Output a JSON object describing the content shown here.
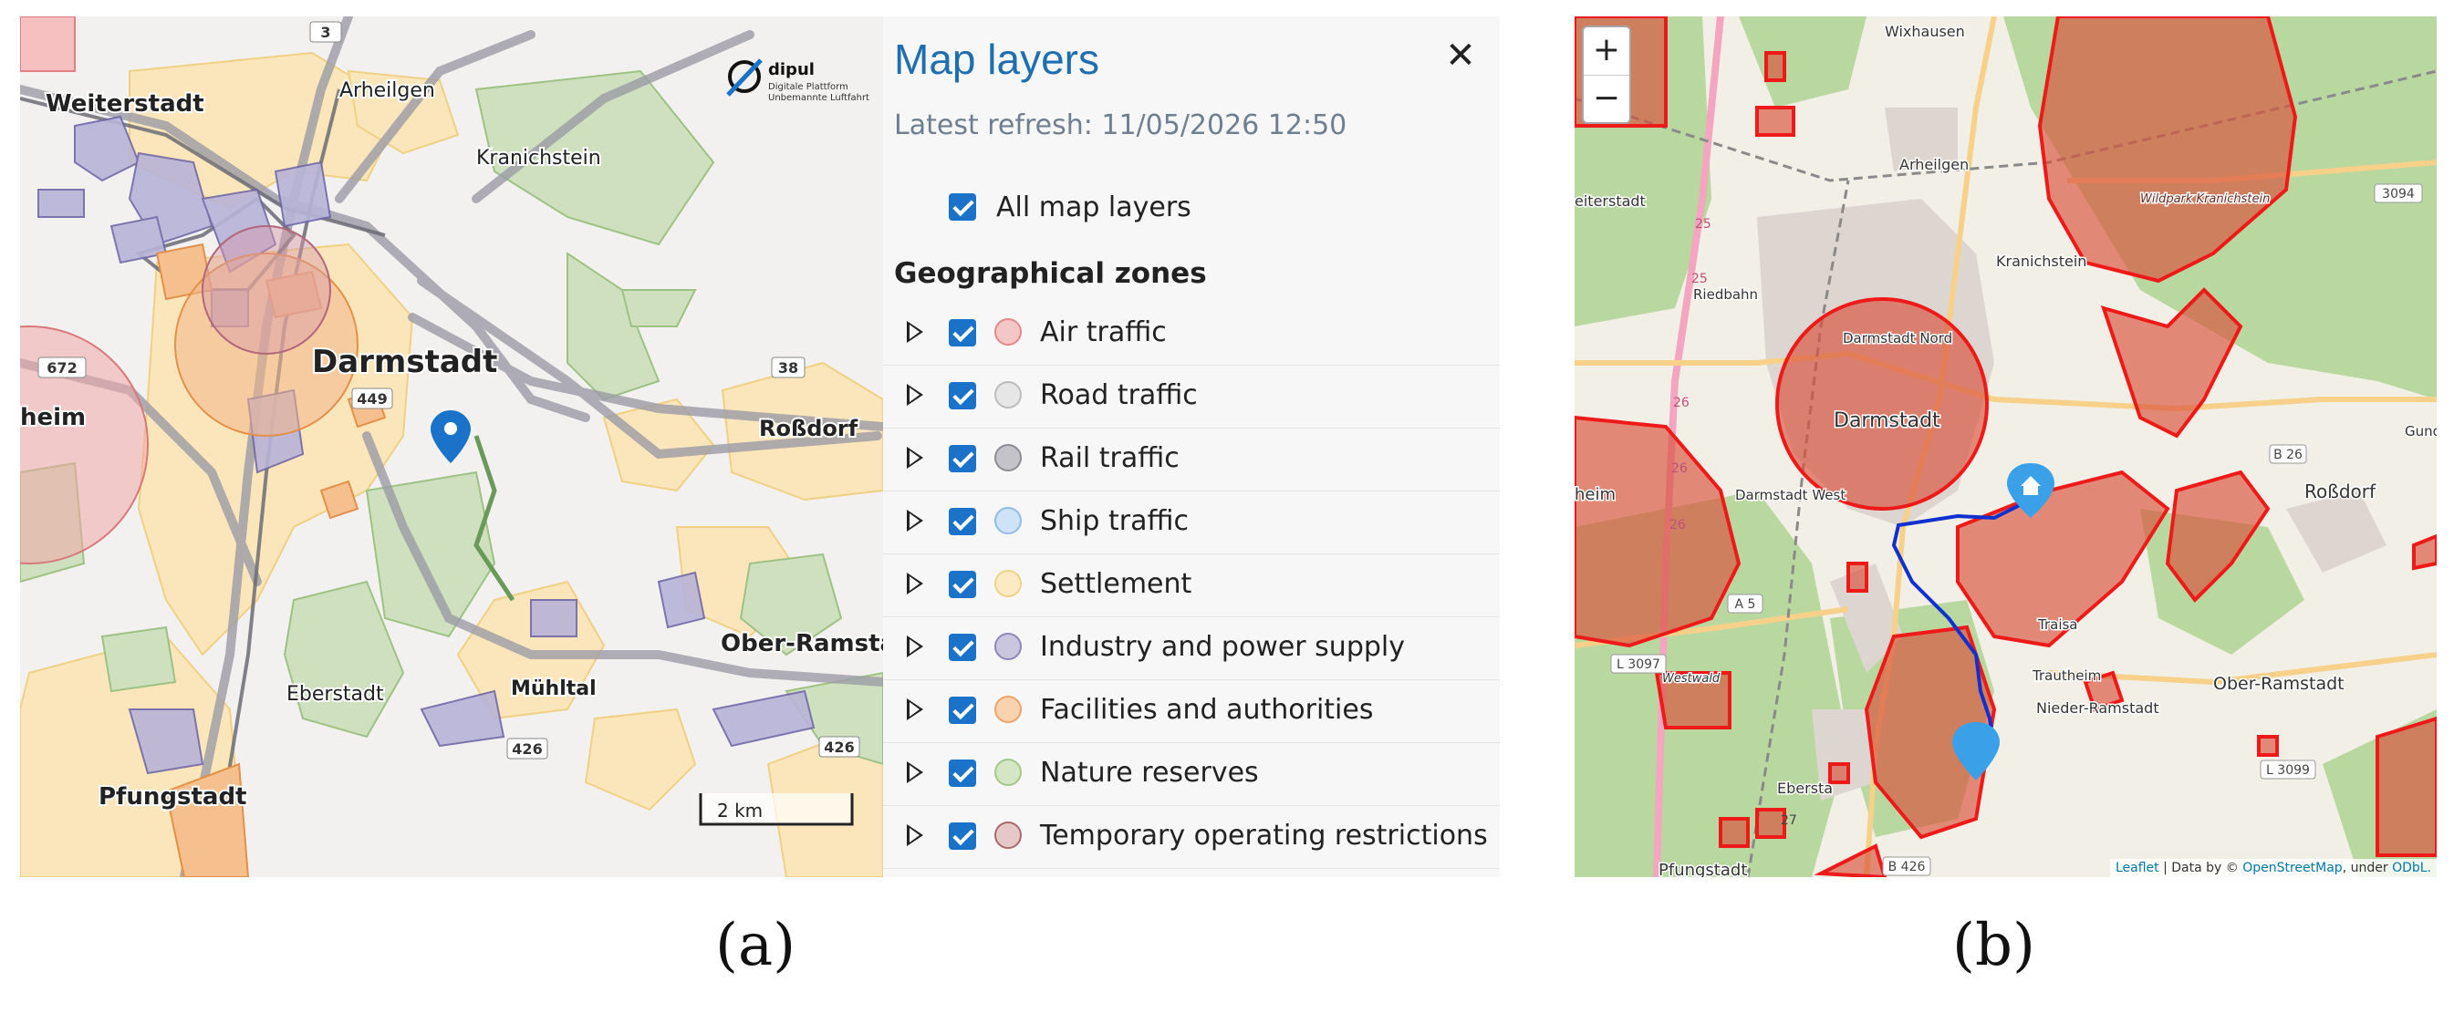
{
  "panel_a": {
    "caption": "(a)",
    "map": {
      "place_labels": {
        "weiterstadt": "Weiterstadt",
        "arheilgen": "Arheilgen",
        "kranichstein": "Kranichstein",
        "darmstadt": "Darmstadt",
        "rossdorf": "Roßdorf",
        "ober_ramstadt": "Ober-Ramstadt",
        "eberstadt": "Eberstadt",
        "muehltal": "Mühltal",
        "pfungstadt": "Pfungstadt",
        "heim": "heim"
      },
      "road_shields": [
        "3",
        "672",
        "38",
        "449",
        "426",
        "426"
      ],
      "logo": {
        "name": "dipul",
        "line1": "Digitale Plattform",
        "line2": "Unbemannte Luftfahrt"
      },
      "scale_bar": "2 km",
      "icons": [
        "location-pin-icon"
      ]
    },
    "layers_panel": {
      "title": "Map layers",
      "close_icon": "close-icon",
      "refresh": "Latest refresh: 11/05/2026 12:50",
      "all_layers": {
        "label": "All map layers",
        "checked": true
      },
      "section": "Geographical zones",
      "layers": [
        {
          "name": "Air traffic",
          "checked": true,
          "fill": "#f4c6c6",
          "stroke": "#e08a8a"
        },
        {
          "name": "Road traffic",
          "checked": true,
          "fill": "#e6e6e6",
          "stroke": "#bcbcbc"
        },
        {
          "name": "Rail traffic",
          "checked": true,
          "fill": "#c4c4c8",
          "stroke": "#8c8c92"
        },
        {
          "name": "Ship traffic",
          "checked": true,
          "fill": "#cfe3f8",
          "stroke": "#8fbde8"
        },
        {
          "name": "Settlement",
          "checked": true,
          "fill": "#fbeac4",
          "stroke": "#efd38a"
        },
        {
          "name": "Industry and power supply",
          "checked": true,
          "fill": "#c9c6de",
          "stroke": "#8e88b8"
        },
        {
          "name": "Facilities and authorities",
          "checked": true,
          "fill": "#f9d2b0",
          "stroke": "#eca46a"
        },
        {
          "name": "Nature reserves",
          "checked": true,
          "fill": "#d4e6c4",
          "stroke": "#a4c88c"
        },
        {
          "name": "Temporary operating restrictions",
          "checked": true,
          "fill": "#e7c8c8",
          "stroke": "#a86a6a"
        }
      ]
    }
  },
  "panel_b": {
    "caption": "(b)",
    "zoom": {
      "in": "+",
      "out": "−"
    },
    "map": {
      "place_labels": {
        "wixhausen": "Wixhausen",
        "arheilgen": "Arheilgen",
        "weiterstadt": "eiterstadt",
        "kranichstein": "Kranichstein",
        "wildpark": "Wildpark Kranichstein",
        "riedbahn": "Riedbahn",
        "darmstadt_nord": "Darmstadt Nord",
        "darmstadt": "Darmstadt",
        "darmstadt_west": "Darmstadt West",
        "rossdorf": "Roßdorf",
        "traisa": "Traisa",
        "trautheim": "Trautheim",
        "nieder_ramstadt": "Nieder-Ramstadt",
        "ober_ramstadt": "Ober-Ramstadt",
        "eberstadt": "Ebersta",
        "pfungstadt": "Pfungstadt",
        "heim": "heim",
        "gund": "Gund",
        "westwald": "Westwald"
      },
      "road_numbers": [
        "3094",
        "25",
        "25",
        "26",
        "26",
        "26",
        "A 5",
        "L 3097",
        "B 26",
        "L 3099",
        "B 426",
        "27"
      ],
      "icons": [
        "home-marker-icon",
        "location-marker-icon"
      ],
      "zone_color": "#e02020",
      "route_color": "#1030d0"
    },
    "attribution": {
      "leaflet": "Leaflet",
      "sep": " | Data by © ",
      "osm": "OpenStreetMap",
      "under": ", under ",
      "odbl": "ODbL."
    }
  }
}
